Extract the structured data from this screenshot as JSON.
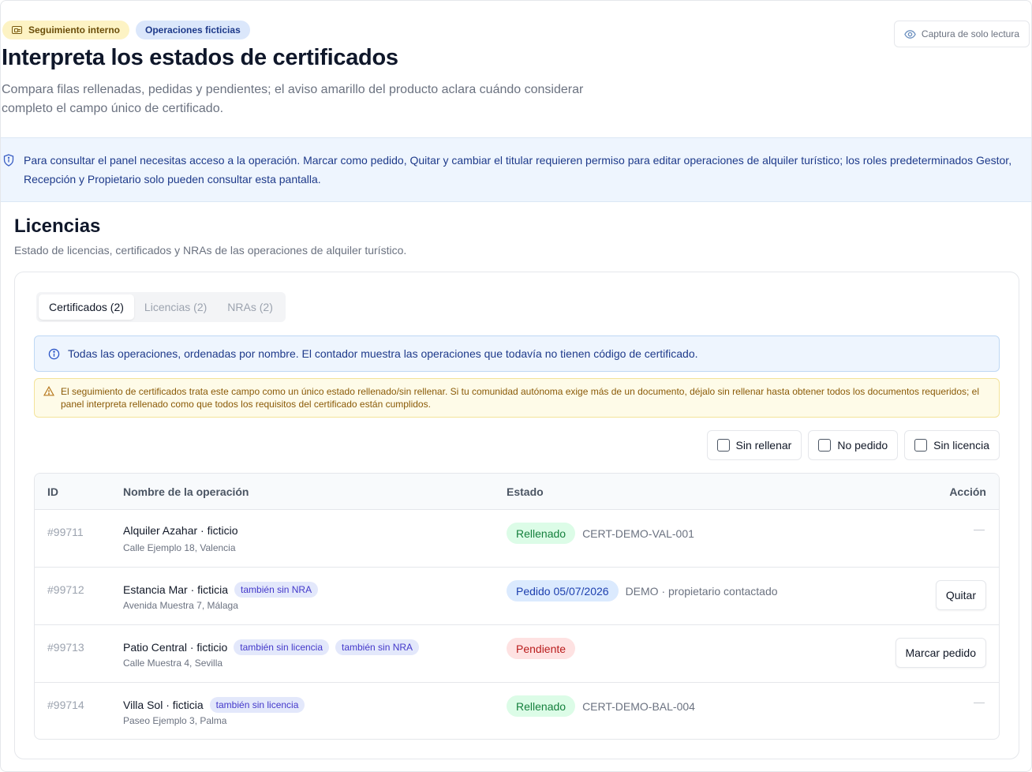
{
  "header": {
    "badge_internal": "Seguimiento interno",
    "badge_ops": "Operaciones ficticias",
    "readonly_label": "Captura de solo lectura",
    "title": "Interpreta los estados de certificados",
    "subtitle": "Compara filas rellenadas, pedidas y pendientes; el aviso amarillo del producto aclara cuándo considerar completo el campo único de certificado."
  },
  "permission_notice": "Para consultar el panel necesitas acceso a la operación. Marcar como pedido, Quitar y cambiar el titular requieren permiso para editar operaciones de alquiler turístico; los roles predeterminados Gestor, Recepción y Propietario solo pueden consultar esta pantalla.",
  "section": {
    "title": "Licencias",
    "description": "Estado de licencias, certificados y NRAs de las operaciones de alquiler turístico."
  },
  "tabs": [
    {
      "label": "Certificados (2)",
      "active": true
    },
    {
      "label": "Licencias (2)",
      "active": false
    },
    {
      "label": "NRAs (2)",
      "active": false
    }
  ],
  "info_message": "Todas las operaciones, ordenadas por nombre. El contador muestra las operaciones que todavía no tienen código de certificado.",
  "warning_message": "El seguimiento de certificados trata este campo como un único estado rellenado/sin rellenar. Si tu comunidad autónoma exige más de un documento, déjalo sin rellenar hasta obtener todos los documentos requeridos; el panel interpreta rellenado como que todos los requisitos del certificado están cumplidos.",
  "filters": {
    "sin_rellenar": "Sin rellenar",
    "no_pedido": "No pedido",
    "sin_licencia": "Sin licencia"
  },
  "table": {
    "columns": {
      "id": "ID",
      "name": "Nombre de la operación",
      "status": "Estado",
      "action": "Acción"
    },
    "rows": [
      {
        "id": "#99711",
        "name": "Alquiler Azahar · ficticio",
        "address": "Calle Ejemplo 18, Valencia",
        "tag1": "",
        "tag2": "",
        "status": "Rellenado",
        "status_color": "#dcfce7",
        "detail": "CERT-DEMO-VAL-001",
        "action": "—"
      },
      {
        "id": "#99712",
        "name": "Estancia Mar · ficticia",
        "address": "Avenida Muestra 7, Málaga",
        "tag1": "también sin NRA",
        "tag2": "",
        "status": "Pedido 05/07/2026",
        "status_color": "#dbeafe",
        "detail": "DEMO · propietario contactado",
        "action": "Quitar"
      },
      {
        "id": "#99713",
        "name": "Patio Central · ficticio",
        "address": "Calle Muestra 4, Sevilla",
        "tag1": "también sin licencia",
        "tag2": "también sin NRA",
        "status": "Pendiente",
        "status_color": "#fee2e2",
        "detail": "",
        "action": "Marcar pedido"
      },
      {
        "id": "#99714",
        "name": "Villa Sol · ficticia",
        "address": "Paseo Ejemplo 3, Palma",
        "tag1": "también sin licencia",
        "tag2": "",
        "status": "Rellenado",
        "status_color": "#dcfce7",
        "detail": "CERT-DEMO-BAL-004",
        "action": "—"
      }
    ]
  }
}
